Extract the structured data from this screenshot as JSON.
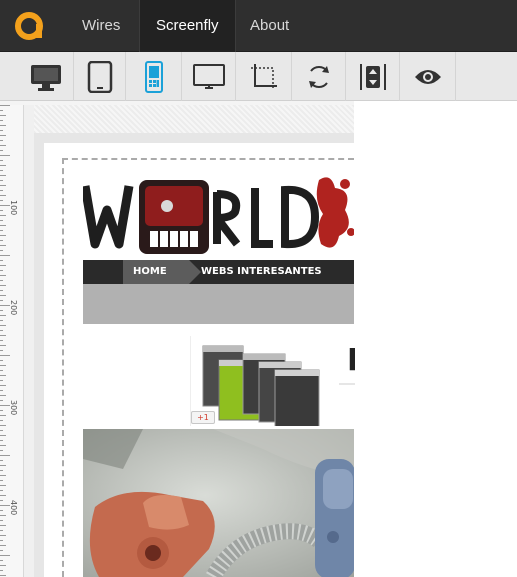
{
  "app": {
    "logo_icon": "screenfly-logo-icon",
    "accent": "#f4a11c"
  },
  "nav": {
    "items": [
      {
        "label": "Wires"
      },
      {
        "label": "Screenfly"
      },
      {
        "label": "About"
      }
    ],
    "active": "Screenfly"
  },
  "toolbar": {
    "tools": [
      {
        "icon": "desktop-icon"
      },
      {
        "icon": "tablet-icon"
      },
      {
        "icon": "mobile-phone-icon",
        "selected": true
      },
      {
        "icon": "television-icon"
      },
      {
        "icon": "custom-size-icon"
      },
      {
        "icon": "rotate-icon"
      },
      {
        "icon": "scroll-toggle-icon"
      },
      {
        "icon": "eye-icon"
      }
    ],
    "selected_color": "#1ba1d8"
  },
  "ruler": {
    "labels": [
      "100",
      "200",
      "300",
      "400"
    ]
  },
  "website": {
    "logo_text": "WORLD",
    "menu": {
      "home": "HOME",
      "link": "WEBS INTERESANTES"
    },
    "banner_letter": "P",
    "gplus": "+1"
  }
}
